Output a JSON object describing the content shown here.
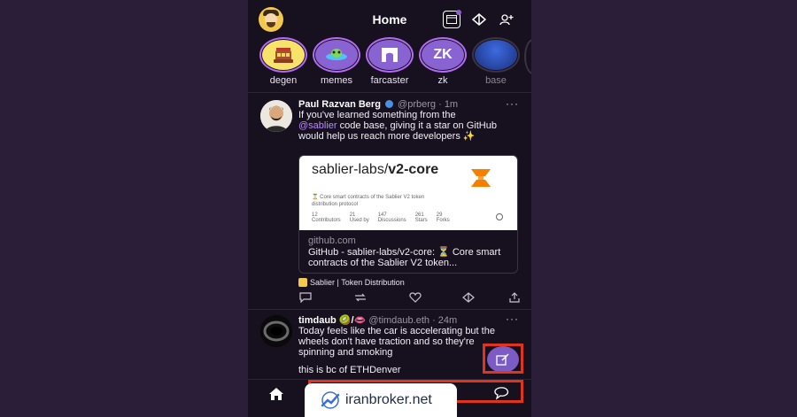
{
  "header": {
    "title": "Home",
    "icons": [
      "frames-icon",
      "diamond-icon",
      "add-user-icon"
    ]
  },
  "channels": [
    {
      "label": "degen",
      "icon": "degen-hat-icon",
      "bg": "#f7e36a"
    },
    {
      "label": "memes",
      "icon": "memes-ufo-icon",
      "bg": "#8a63d2"
    },
    {
      "label": "farcaster",
      "icon": "farcaster-arch-icon",
      "bg": "#8a63d2"
    },
    {
      "label": "zk",
      "icon": "zk-text-icon",
      "bg": "#8a63d2",
      "text": "ZK"
    },
    {
      "label": "base",
      "icon": "base-circle-icon",
      "bg": "#1f4ab8"
    }
  ],
  "post1": {
    "author": "Paul Razvan Berg",
    "handle": "@prberg",
    "time": "1m",
    "line1": "If you've learned something from the",
    "mention": "@sablier",
    "line2": " code base, giving it a star on GitHub would help us reach more developers ✨",
    "card": {
      "preview_title_a": "sablier-labs/",
      "preview_title_b": "v2-core",
      "preview_desc": "⏳ Core smart contracts of the Sablier V2 token distribution protocol",
      "stats": [
        {
          "value": "12",
          "label": "Contributors"
        },
        {
          "value": "21",
          "label": "Used by"
        },
        {
          "value": "147",
          "label": "Discussions"
        },
        {
          "value": "261",
          "label": "Stars"
        },
        {
          "value": "29",
          "label": "Forks"
        }
      ],
      "domain": "github.com",
      "link_title": "GitHub - sablier-labs/v2-core: ⏳ Core smart contracts of the Sablier V2 token..."
    },
    "channel_tag": "Sablier | Token Distribution"
  },
  "post2": {
    "author": "timdaub 🥝/👄",
    "handle": "@timdaub.eth",
    "time": "24m",
    "text": "Today feels like the car is accelerating but the wheels don't have traction and so they're spinning and smoking",
    "text2": "this is bc of ETHDenver"
  },
  "watermark": "iranbroker.net",
  "colors": {
    "background": "#17101f",
    "accent": "#8a63d2",
    "highlight_frame": "#e0341e"
  }
}
